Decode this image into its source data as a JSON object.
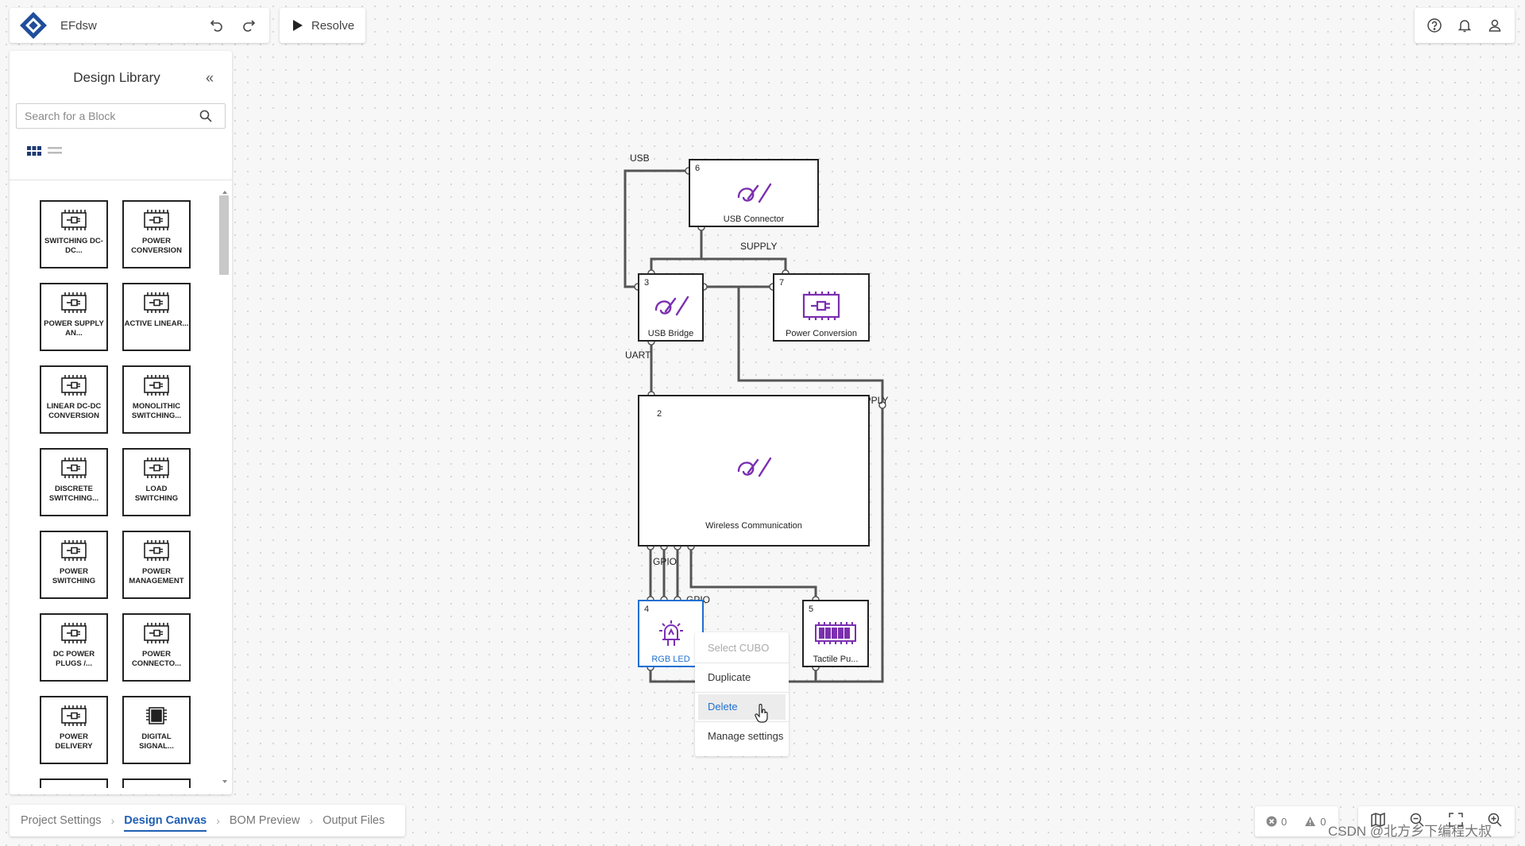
{
  "colors": {
    "accent": "#1f6fd1",
    "purple": "#7b2fb0",
    "node_border": "#222222",
    "brand": "#1f4e9c"
  },
  "header": {
    "project_name": "EFdsw",
    "undo_icon": "undo-icon",
    "redo_icon": "redo-icon",
    "resolve_label": "Resolve",
    "right_icons": [
      "help-icon",
      "bell-icon",
      "user-icon"
    ]
  },
  "library": {
    "title": "Design Library",
    "search_placeholder": "Search for a Block",
    "blocks": [
      {
        "label": "SWITCHING DC-DC..."
      },
      {
        "label": "POWER CONVERSION"
      },
      {
        "label": "POWER SUPPLY AN..."
      },
      {
        "label": "ACTIVE LINEAR..."
      },
      {
        "label": "LINEAR DC-DC CONVERSION"
      },
      {
        "label": "MONOLITHIC SWITCHING..."
      },
      {
        "label": "DISCRETE SWITCHING..."
      },
      {
        "label": "LOAD SWITCHING"
      },
      {
        "label": "POWER SWITCHING"
      },
      {
        "label": "POWER MANAGEMENT"
      },
      {
        "label": "DC POWER PLUGS /..."
      },
      {
        "label": "POWER CONNECTO..."
      },
      {
        "label": "POWER DELIVERY"
      },
      {
        "label": "DIGITAL SIGNAL..."
      }
    ]
  },
  "canvas": {
    "nodes": [
      {
        "id": "6",
        "name": "USB Connector"
      },
      {
        "id": "3",
        "name": "USB Bridge"
      },
      {
        "id": "7",
        "name": "Power Conversion"
      },
      {
        "id": "2",
        "name": "Wireless Communication"
      },
      {
        "id": "4",
        "name": "RGB LED"
      },
      {
        "id": "5",
        "name": "Tactile Pu..."
      }
    ],
    "nets": {
      "usb": "USB",
      "supply_top": "SUPPLY",
      "uart": "UART",
      "supply_right": "SUPPLY",
      "gpio_1": "GPIO",
      "gpio_2": "GPIO"
    }
  },
  "context_menu": {
    "items": [
      "Select CUBO",
      "Duplicate",
      "Delete",
      "Manage settings"
    ]
  },
  "footer": {
    "tabs": [
      "Project Settings",
      "Design Canvas",
      "BOM Preview",
      "Output Files"
    ],
    "active_tab": "Design Canvas",
    "errors": "0",
    "warnings": "0"
  },
  "watermark": "CSDN @北方乡下编程大叔"
}
